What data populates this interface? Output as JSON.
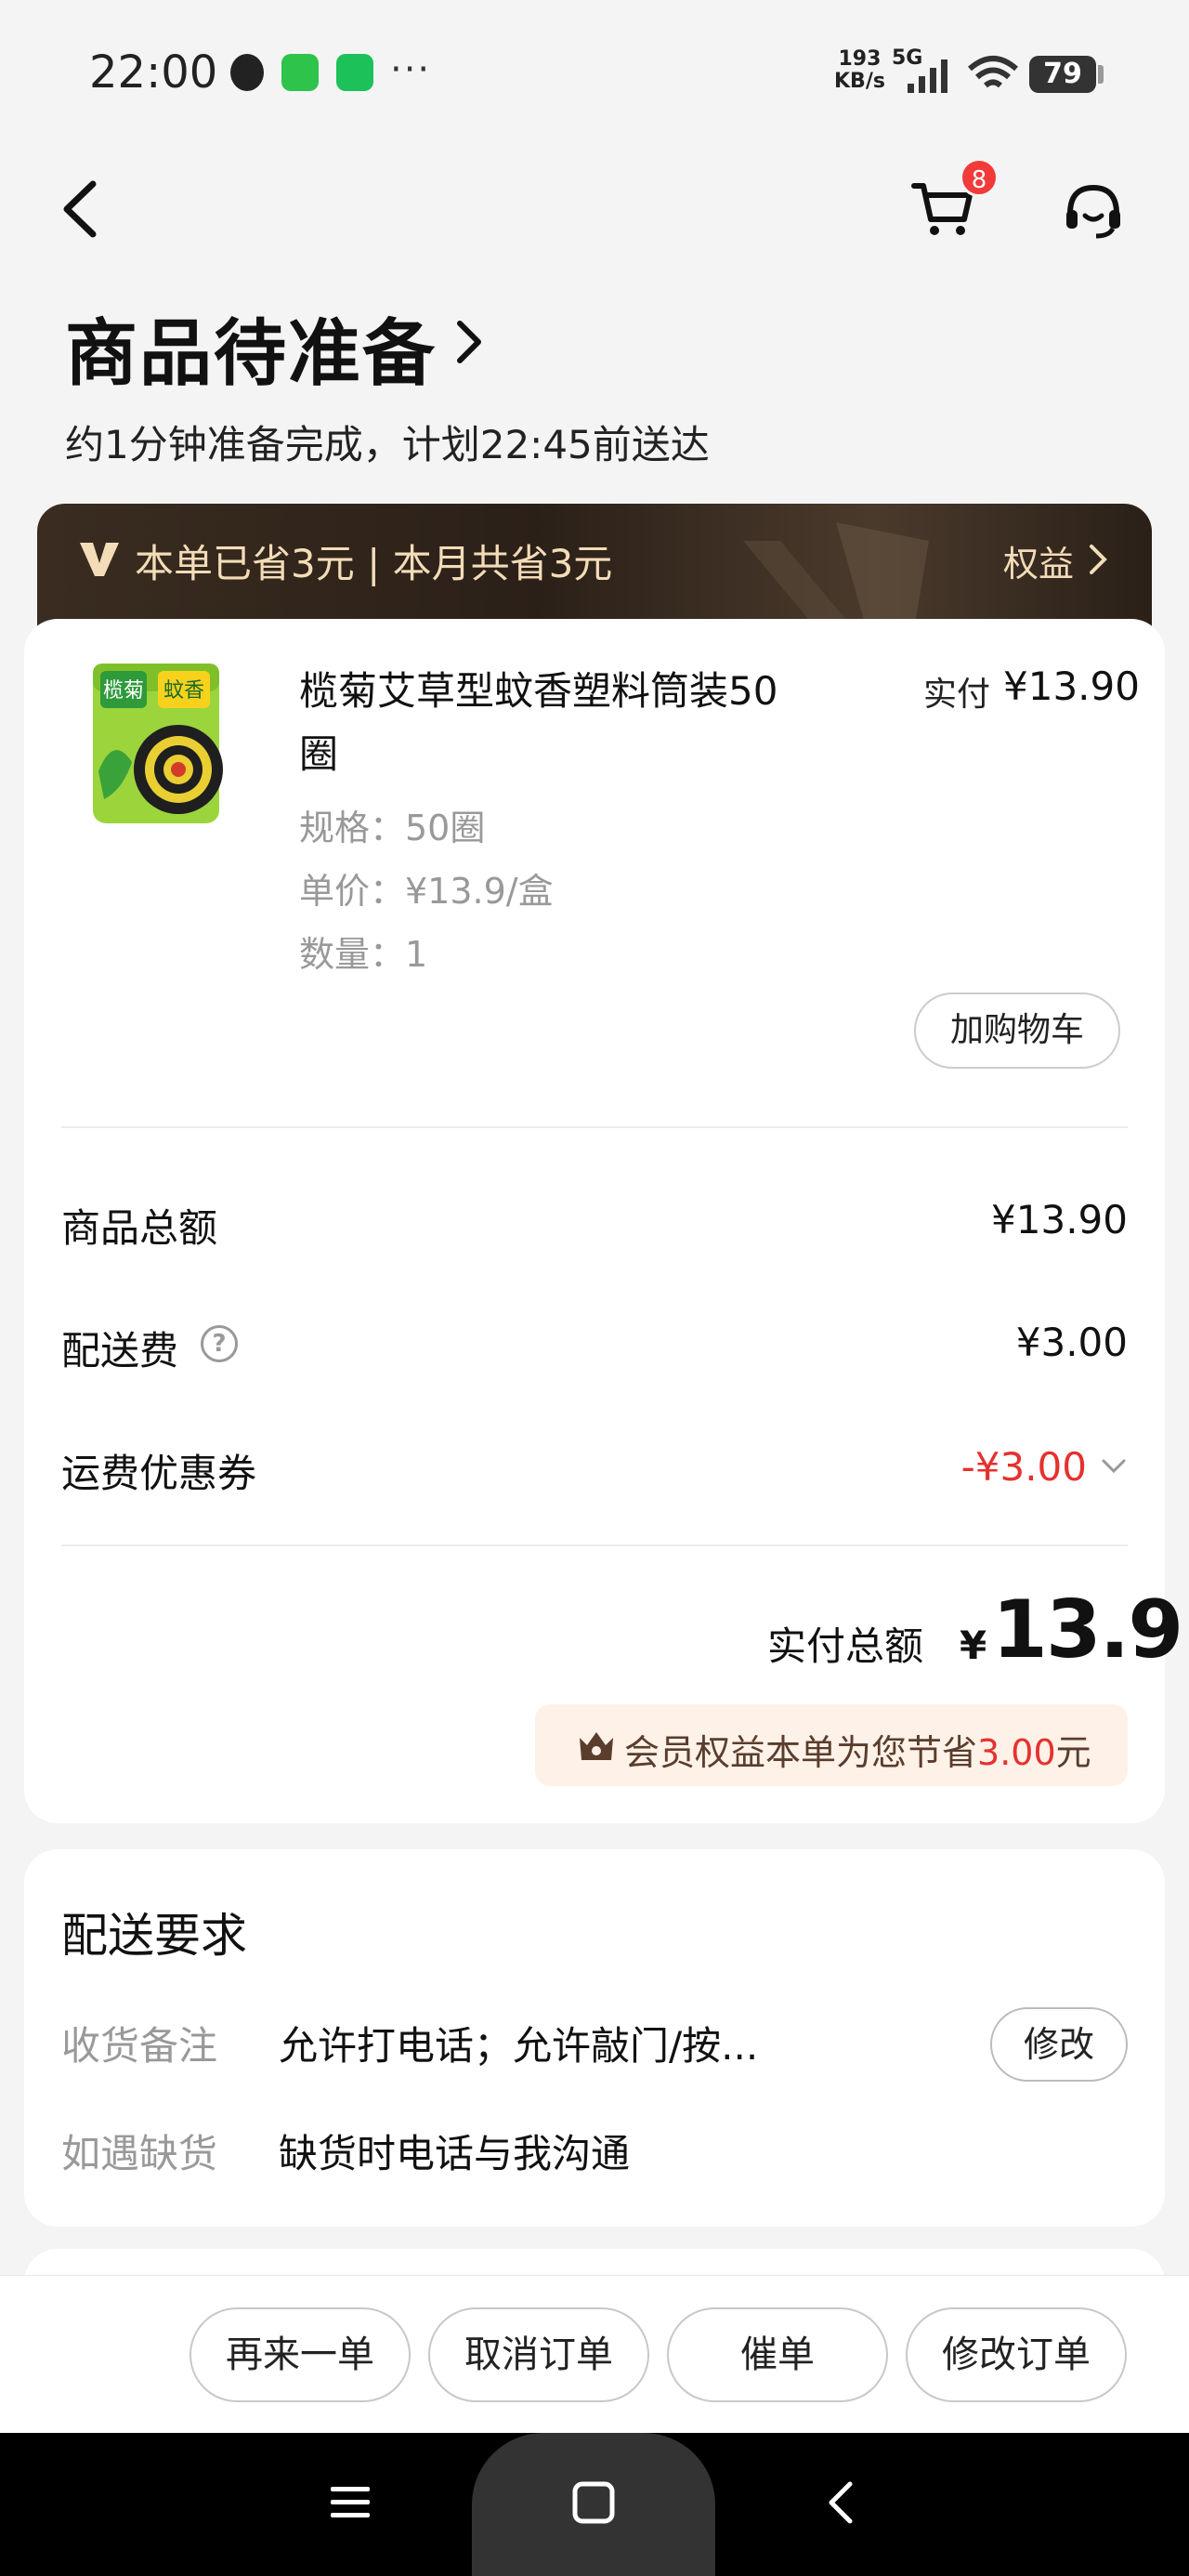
{
  "status_bar": {
    "time": "22:00",
    "net_speed_value": "193",
    "net_speed_unit": "KB/s",
    "network": "5G",
    "battery": "79",
    "icons": [
      "qq-icon",
      "message-icon",
      "wechat-icon",
      "more-dots-icon",
      "signal-icon",
      "wifi-icon",
      "battery-icon"
    ]
  },
  "header": {
    "cart_badge": "8",
    "title": "商品待准备",
    "subtitle": "约1分钟准备完成，计划22:45前送达"
  },
  "banner": {
    "text": "本单已省3元 | 本月共省3元",
    "right_label": "权益"
  },
  "order": {
    "product_name": "榄菊艾草型蚊香塑料筒装50圈",
    "paid_label": "实付",
    "paid_value": "¥13.90",
    "spec": "规格：50圈",
    "unit_price": "单价：¥13.9/盒",
    "quantity": "数量：1",
    "add_cart_label": "加购物车",
    "product_image_labels": [
      "榄菊",
      "蚊香"
    ]
  },
  "summary": {
    "goods_total_label": "商品总额",
    "goods_total_value": "¥13.90",
    "delivery_fee_label": "配送费",
    "delivery_fee_value": "¥3.00",
    "coupon_label": "运费优惠券",
    "coupon_value": "-¥3.00",
    "paid_total_label": "实付总额",
    "paid_total_currency": "¥",
    "paid_total_value": "13.9",
    "member_text_prefix": "会员权益本单为您节省",
    "member_amount": "3.00",
    "member_text_suffix": "元"
  },
  "delivery": {
    "title": "配送要求",
    "note_label": "收货备注",
    "note_value": "允许打电话；允许敲门/按...",
    "edit_label": "修改",
    "stockout_label": "如遇缺货",
    "stockout_value": "缺货时电话与我沟通"
  },
  "actions": {
    "reorder": "再来一单",
    "cancel": "取消订单",
    "urge": "催单",
    "modify": "修改订单"
  },
  "colors": {
    "accent_red": "#e5312d",
    "banner_gold": "#f3dcb8",
    "background": "#f4f4f4"
  }
}
